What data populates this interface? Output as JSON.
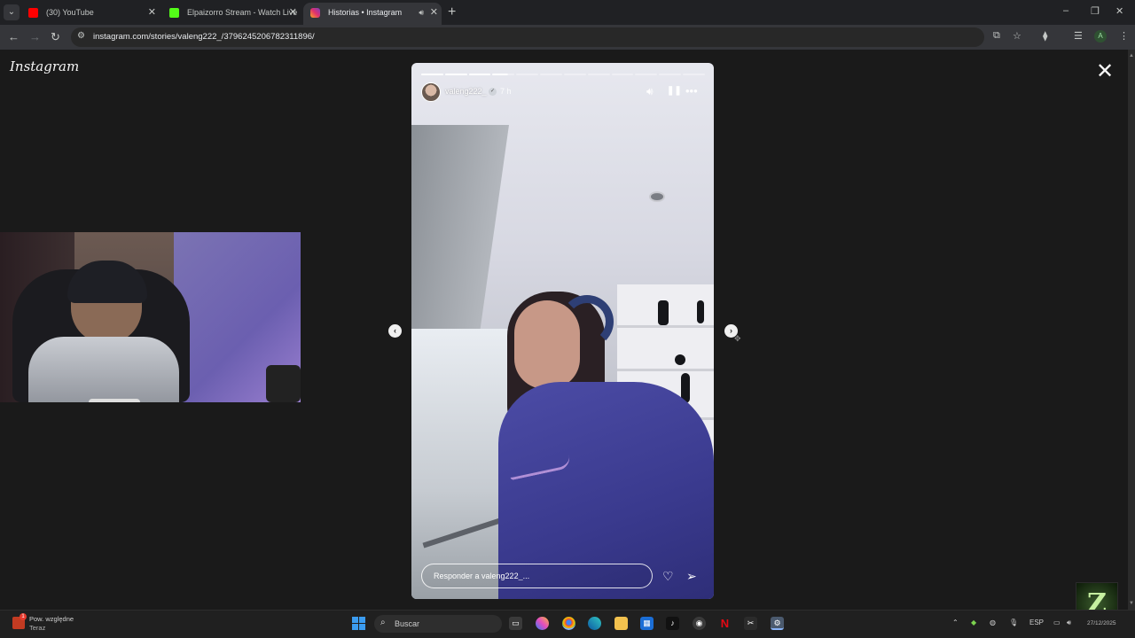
{
  "browser": {
    "tabs": [
      {
        "label": "(30) YouTube",
        "favicon_color": "#ff0000",
        "active": false
      },
      {
        "label": "Elpaizorro Stream - Watch Live",
        "favicon_color": "#53fc18",
        "active": false
      },
      {
        "label": "Historias • Instagram",
        "favicon_color": "#e1306c",
        "active": true
      }
    ],
    "new_tab": "+",
    "url": "instagram.com/stories/valeng222_/3796245206782311896/",
    "profile_initial": "A"
  },
  "page": {
    "logo": "Instagram",
    "close_icon": "close-icon"
  },
  "story": {
    "segments_total": 12,
    "segments_done": 3,
    "username": "valeng222_",
    "time": "7 h",
    "reply_placeholder": "Responder a valeng222_...",
    "icons": {
      "sound": "speaker-icon",
      "pause": "pause-icon",
      "more": "more-icon",
      "like": "heart-icon",
      "share": "send-icon"
    }
  },
  "taskbar": {
    "notification_title": "Pow. względne",
    "notification_subtitle": "Teraz",
    "notification_count": "1",
    "search_placeholder": "Buscar",
    "language": "ESP",
    "date": "27/12/2025"
  },
  "overlay": {
    "channel_logo": "Z"
  },
  "colors": {
    "accent_blue": "#3b9cf0",
    "instagram_pink": "#e1306c"
  }
}
